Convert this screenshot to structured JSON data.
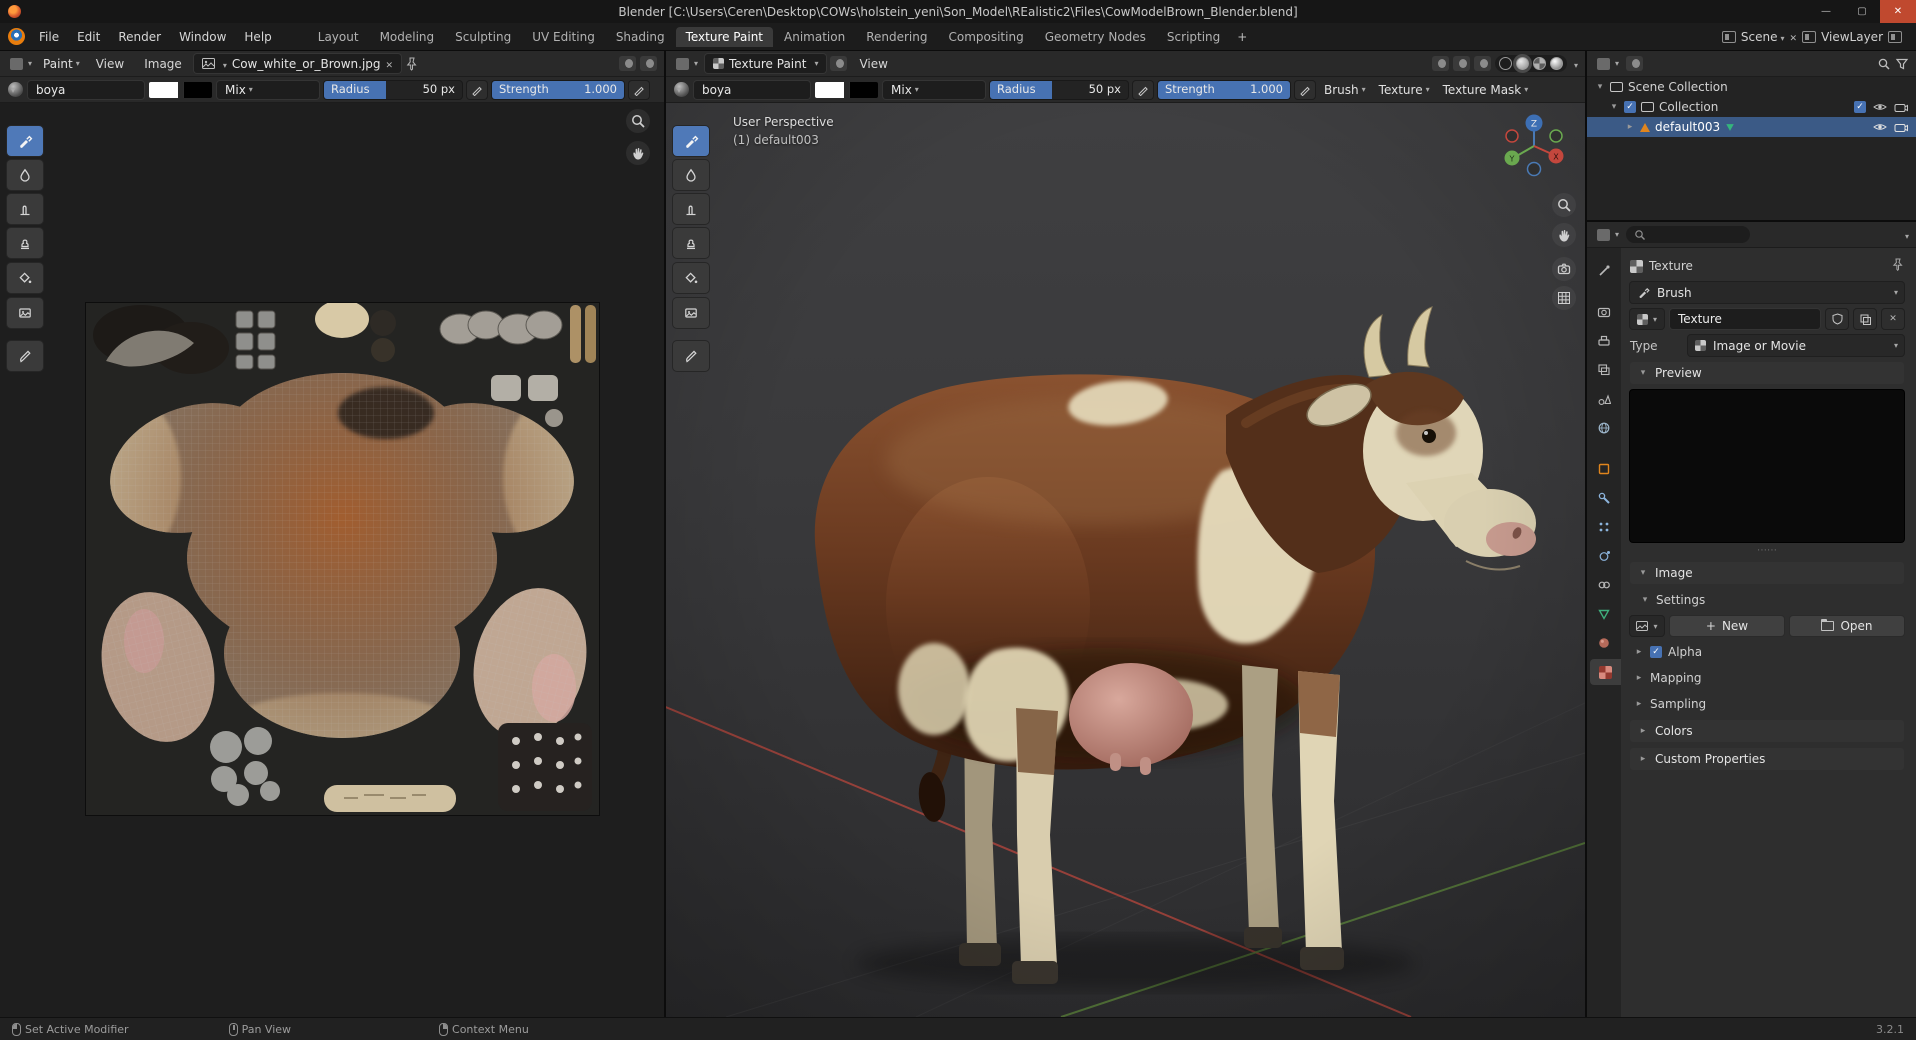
{
  "window": {
    "title": "Blender [C:\\Users\\Ceren\\Desktop\\COWs\\holstein_yeni\\Son_Model\\REalistic2\\Files\\CowModelBrown_Blender.blend]",
    "minimize": "—",
    "maximize": "▢",
    "close": "✕"
  },
  "topbar": {
    "menus": [
      "File",
      "Edit",
      "Render",
      "Window",
      "Help"
    ],
    "workspaces": [
      "Layout",
      "Modeling",
      "Sculpting",
      "UV Editing",
      "Shading",
      "Texture Paint",
      "Animation",
      "Rendering",
      "Compositing",
      "Geometry Nodes",
      "Scripting"
    ],
    "active_workspace": "Texture Paint",
    "add_tab": "+",
    "scene_label": "Scene",
    "viewlayer_label": "ViewLayer"
  },
  "image_editor": {
    "mode": "Paint",
    "menus": [
      "View",
      "Image"
    ],
    "image_name": "Cow_white_or_Brown.jpg",
    "brush": {
      "name": "boya",
      "blend": "Mix",
      "radius_label": "Radius",
      "radius_value": "50 px",
      "radius_fill_pct": 45,
      "strength_label": "Strength",
      "strength_value": "1.000",
      "strength_fill_pct": 100
    }
  },
  "viewport": {
    "mode": "Texture Paint",
    "menu_view": "View",
    "brush": {
      "name": "boya",
      "blend": "Mix",
      "radius_label": "Radius",
      "radius_value": "50 px",
      "strength_label": "Strength",
      "strength_value": "1.000"
    },
    "popovers": {
      "brush": "Brush",
      "texture": "Texture",
      "texture_mask": "Texture Mask"
    },
    "overlay": {
      "line1": "User Perspective",
      "line2": "(1) default003"
    },
    "gizmo": {
      "x": "X",
      "y": "Y",
      "z": "Z"
    }
  },
  "outliner": {
    "rows": [
      {
        "label": "Scene Collection"
      },
      {
        "label": "Collection"
      },
      {
        "label": "default003"
      }
    ]
  },
  "properties": {
    "breadcrumb": "Texture",
    "brush_selector": "Brush",
    "texture_name": "Texture",
    "type_label": "Type",
    "type_value": "Image or Movie",
    "sections": {
      "preview": "Preview",
      "image": "Image",
      "settings": "Settings",
      "alpha": "Alpha",
      "mapping": "Mapping",
      "sampling": "Sampling",
      "colors": "Colors",
      "custom_properties": "Custom Properties"
    },
    "buttons": {
      "new": "New",
      "open": "Open"
    }
  },
  "statusbar": {
    "hint_left": "Set Active Modifier",
    "hint_middle": "Pan View",
    "hint_right": "Context Menu",
    "version": "3.2.1"
  },
  "colors": {
    "accent": "#4772b3",
    "selection": "#3b5a86",
    "object_orange": "#e0851d",
    "axis_x": "#c4473d",
    "axis_y": "#6aa84f",
    "axis_z": "#3d6fb4"
  }
}
